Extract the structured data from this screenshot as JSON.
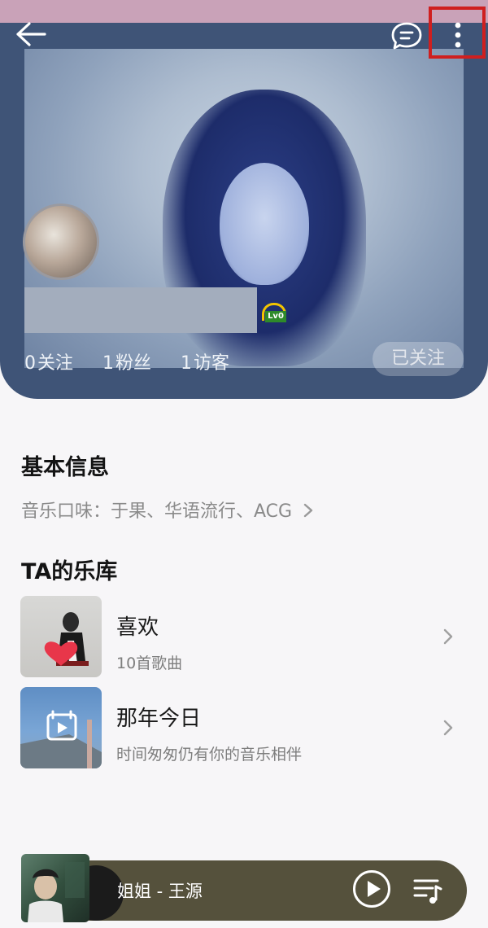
{
  "header": {
    "stats": [
      {
        "num": "0",
        "label": "关注"
      },
      {
        "num": "1",
        "label": "粉丝"
      },
      {
        "num": "1",
        "label": "访客"
      }
    ],
    "level_badge": "Lv0",
    "follow_button": "已关注"
  },
  "basic_info": {
    "title": "基本信息",
    "taste_line": "音乐口味：于果、华语流行、ACG"
  },
  "library": {
    "title": "TA的乐库",
    "items": [
      {
        "title": "喜欢",
        "subtitle": "10首歌曲"
      },
      {
        "title": "那年今日",
        "subtitle": "时间匆匆仍有你的音乐相伴"
      }
    ]
  },
  "player": {
    "song": "姐姐 - 王源"
  },
  "icons": {
    "back": "back-arrow-icon",
    "message": "message-bubble-icon",
    "more": "more-vertical-icon"
  },
  "colors": {
    "header_bg": "#3f5477",
    "player_bg": "#55513c",
    "highlight_box": "#cf1f1f"
  }
}
